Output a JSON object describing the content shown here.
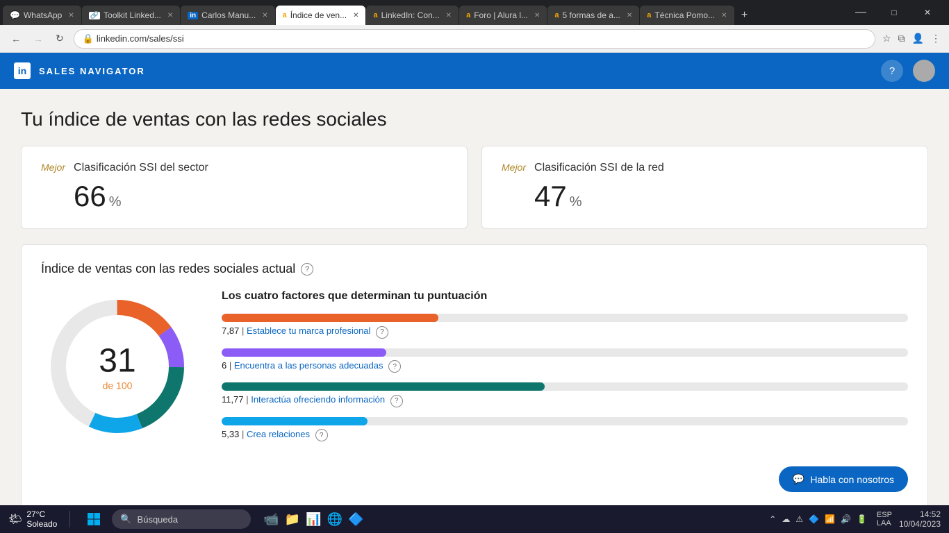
{
  "browser": {
    "tabs": [
      {
        "id": "whatsapp",
        "label": "WhatsApp",
        "icon": "💬",
        "active": false,
        "favicon_color": "#25d366"
      },
      {
        "id": "toolkit",
        "label": "Toolkit Linked...",
        "icon": "🔗",
        "active": false,
        "favicon_color": "#0a66c2"
      },
      {
        "id": "carlos",
        "label": "Carlos Manu...",
        "icon": "in",
        "active": false,
        "favicon_color": "#0a66c2"
      },
      {
        "id": "indice",
        "label": "Índice de ven...",
        "icon": "a",
        "active": true,
        "favicon_color": "#f0a500"
      },
      {
        "id": "linkedin-com",
        "label": "LinkedIn: Con...",
        "icon": "a",
        "active": false,
        "favicon_color": "#f0a500"
      },
      {
        "id": "foro",
        "label": "Foro | Alura l...",
        "icon": "a",
        "active": false,
        "favicon_color": "#f0a500"
      },
      {
        "id": "5formas",
        "label": "5 formas de a...",
        "icon": "a",
        "active": false,
        "favicon_color": "#f0a500"
      },
      {
        "id": "tecnica",
        "label": "Técnica Pomo...",
        "icon": "a",
        "active": false,
        "favicon_color": "#f0a500"
      }
    ],
    "url": "linkedin.com/sales/ssi",
    "nav": {
      "back": "←",
      "forward": "→",
      "refresh": "↻"
    }
  },
  "header": {
    "logo_text": "in",
    "title": "SALES NAVIGATOR",
    "help_icon": "?",
    "avatar_text": ""
  },
  "page": {
    "title": "Tu índice de ventas con las redes sociales",
    "card_sector": {
      "label": "Mejor",
      "subtitle": "Clasificación SSI del sector",
      "value": "66",
      "unit": "%"
    },
    "card_red": {
      "label": "Mejor",
      "subtitle": "Clasificación SSI de la red",
      "value": "47",
      "unit": "%"
    },
    "ssi_section": {
      "title": "Índice de ventas con las redes sociales actual",
      "score": "31",
      "score_sub": "de 100",
      "factors_title": "Los cuatro factores que determinan tu puntuación",
      "factors": [
        {
          "id": "marca",
          "score": "7,87",
          "label": "Establece tu marca profesional",
          "color": "#e8622a",
          "fill_pct": 31.6
        },
        {
          "id": "personas",
          "score": "6",
          "label": "Encuentra a las personas adecuadas",
          "color": "#8b5cf6",
          "fill_pct": 24
        },
        {
          "id": "informacion",
          "score": "11,77",
          "label": "Interactúa ofreciendo información",
          "color": "#0f766e",
          "fill_pct": 47.1
        },
        {
          "id": "relaciones",
          "score": "5,33",
          "label": "Crea relaciones",
          "color": "#0ea5e9",
          "fill_pct": 21.3
        }
      ],
      "chat_button": "Habla con nosotros"
    }
  },
  "taskbar": {
    "weather_icon": "🌤",
    "temperature": "27°C",
    "condition": "Soleado",
    "search_placeholder": "Búsqueda",
    "right": {
      "language": "ESP\nLAA",
      "time": "14:52",
      "date": "10/04/2023"
    }
  }
}
